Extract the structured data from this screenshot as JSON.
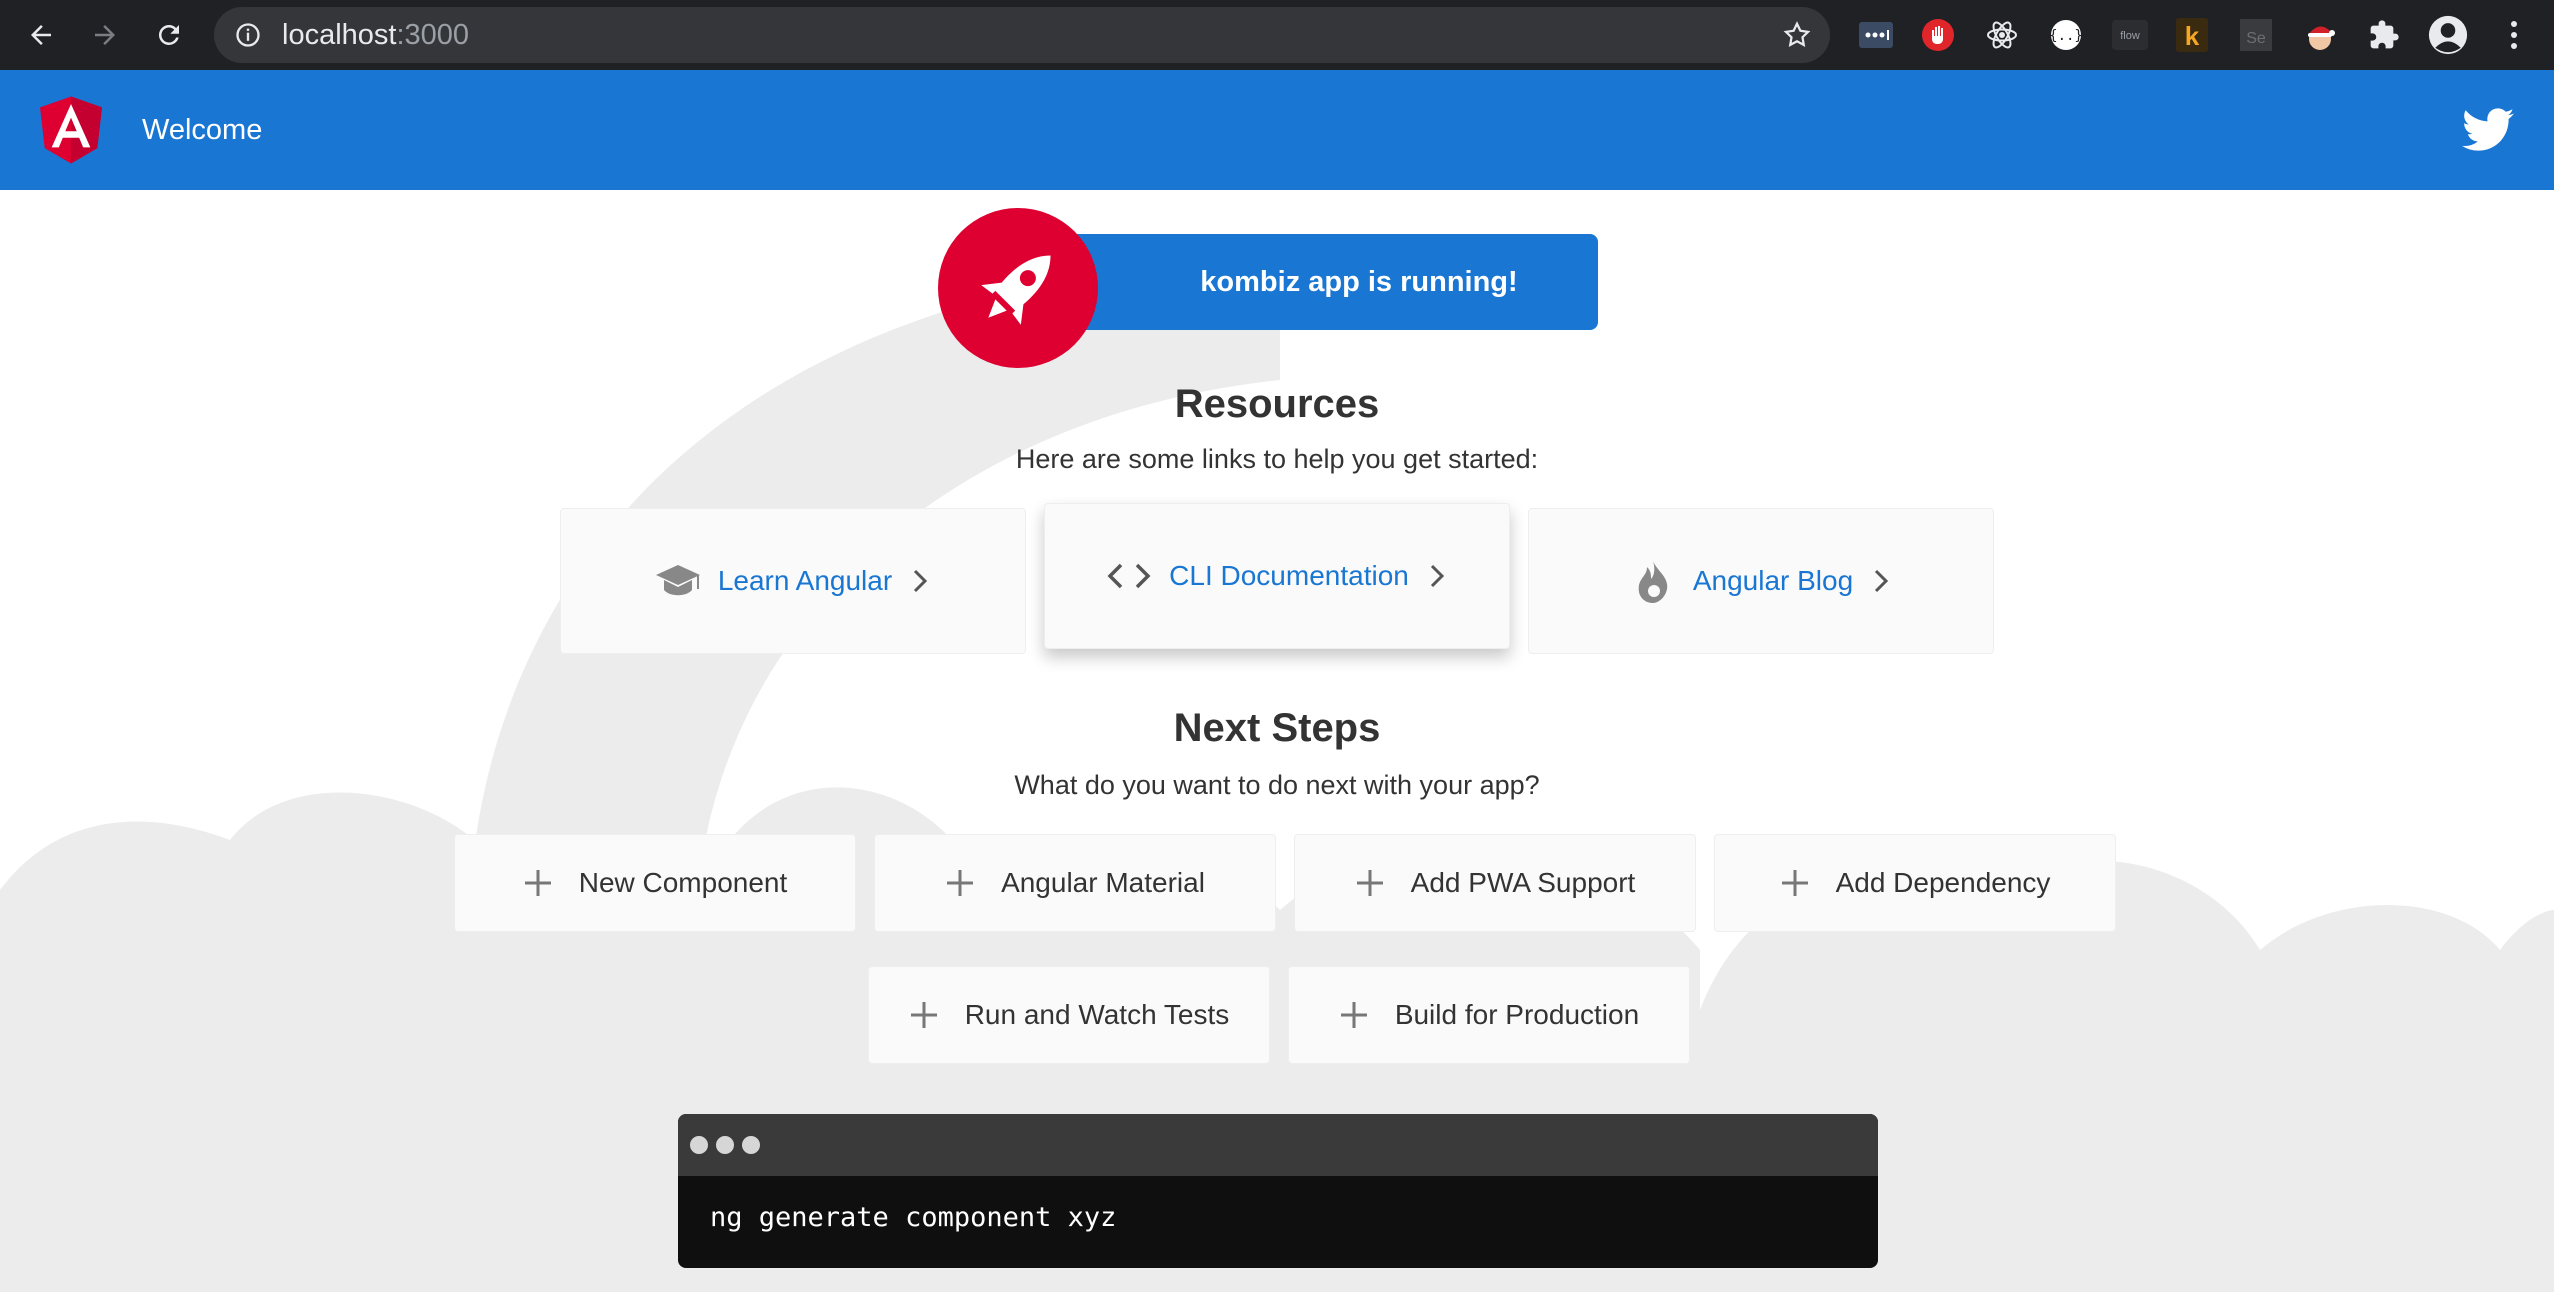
{
  "browser": {
    "url_host": "localhost",
    "url_port": ":3000",
    "extensions": [
      "extension-dots-icon",
      "extension-hand-icon",
      "react-devtools-icon",
      "json-viewer-icon",
      "flow-extension-icon",
      "k-extension-icon",
      "se-extension-icon",
      "santa-extension-icon",
      "puzzle-extensions-icon",
      "profile-avatar-icon",
      "more-menu-icon"
    ],
    "flow_label": "flow",
    "k_label": "k",
    "se_label": "Se"
  },
  "toolbar": {
    "title": "Welcome",
    "color": "#1976d2"
  },
  "banner": {
    "text": "kombiz app is running!"
  },
  "resources": {
    "title": "Resources",
    "subtitle": "Here are some links to help you get started:",
    "cards": [
      {
        "label": "Learn Angular",
        "icon": "graduation-cap-icon"
      },
      {
        "label": "CLI Documentation",
        "icon": "code-brackets-icon"
      },
      {
        "label": "Angular Blog",
        "icon": "flame-icon"
      }
    ]
  },
  "next_steps": {
    "title": "Next Steps",
    "subtitle": "What do you want to do next with your app?",
    "cards": [
      {
        "label": "New Component"
      },
      {
        "label": "Angular Material"
      },
      {
        "label": "Add PWA Support"
      },
      {
        "label": "Add Dependency"
      },
      {
        "label": "Run and Watch Tests"
      },
      {
        "label": "Build for Production"
      }
    ]
  },
  "terminal": {
    "command": "ng generate component xyz"
  },
  "colors": {
    "angular_red": "#dd0031",
    "primary_blue": "#1976d2",
    "chrome_dark": "#202124"
  }
}
